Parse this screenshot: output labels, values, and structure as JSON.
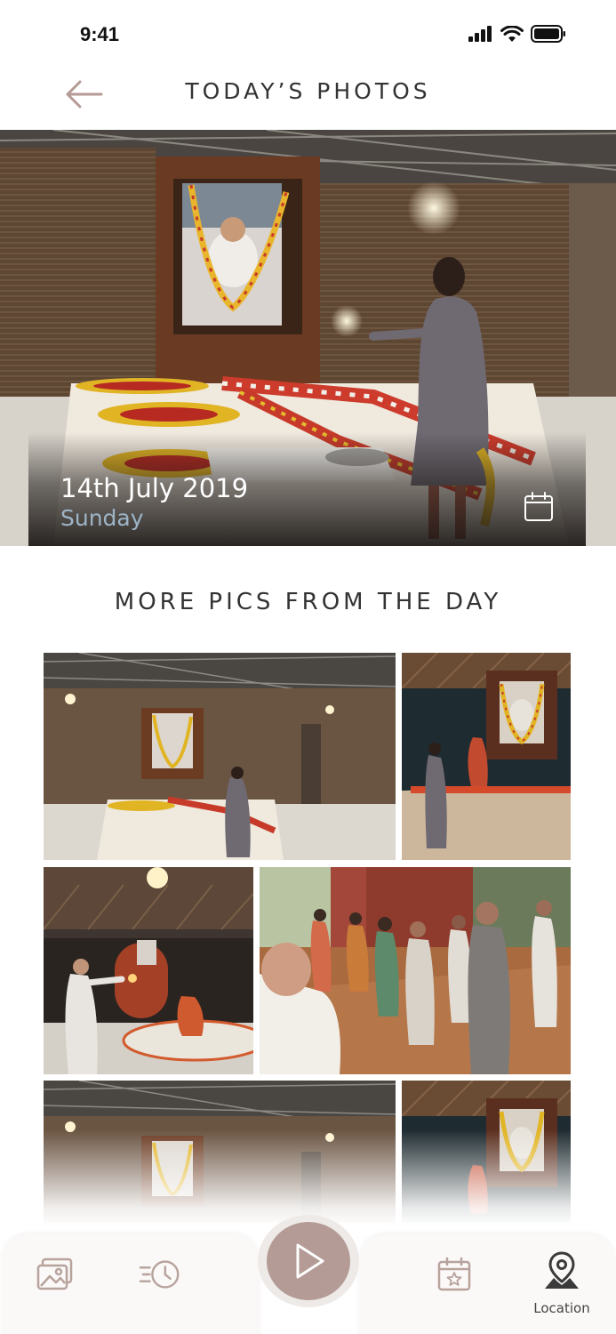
{
  "status_bar": {
    "time": "9:41",
    "icons": [
      "signal-icon",
      "wifi-icon",
      "battery-icon"
    ]
  },
  "header": {
    "title": "TODAY’S PHOTOS",
    "back_icon": "arrow-left-icon"
  },
  "hero": {
    "date": "14th July 2019",
    "day": "Sunday",
    "calendar_icon": "calendar-icon"
  },
  "more_section": {
    "title": "MORE PICS FROM THE DAY"
  },
  "grid": [
    {
      "name": "hall-photo"
    },
    {
      "name": "shrine-photo"
    },
    {
      "name": "aarti-photo"
    },
    {
      "name": "devotees-photo"
    },
    {
      "name": "hall-photo-2"
    },
    {
      "name": "shrine-photo-2"
    }
  ],
  "bottom_nav": {
    "items": [
      {
        "icon": "gallery-icon",
        "active": false
      },
      {
        "icon": "history-icon",
        "active": false
      },
      {
        "icon": "play-icon",
        "active": false
      },
      {
        "icon": "calendar-star-icon",
        "active": false
      },
      {
        "icon": "location-pin-icon",
        "active": true,
        "label": "Location"
      }
    ]
  },
  "colors": {
    "accent": "#b49b95",
    "day_text": "#9db4c7",
    "back_arrow": "#b49b95",
    "nav_icon": "#b7a29c"
  }
}
